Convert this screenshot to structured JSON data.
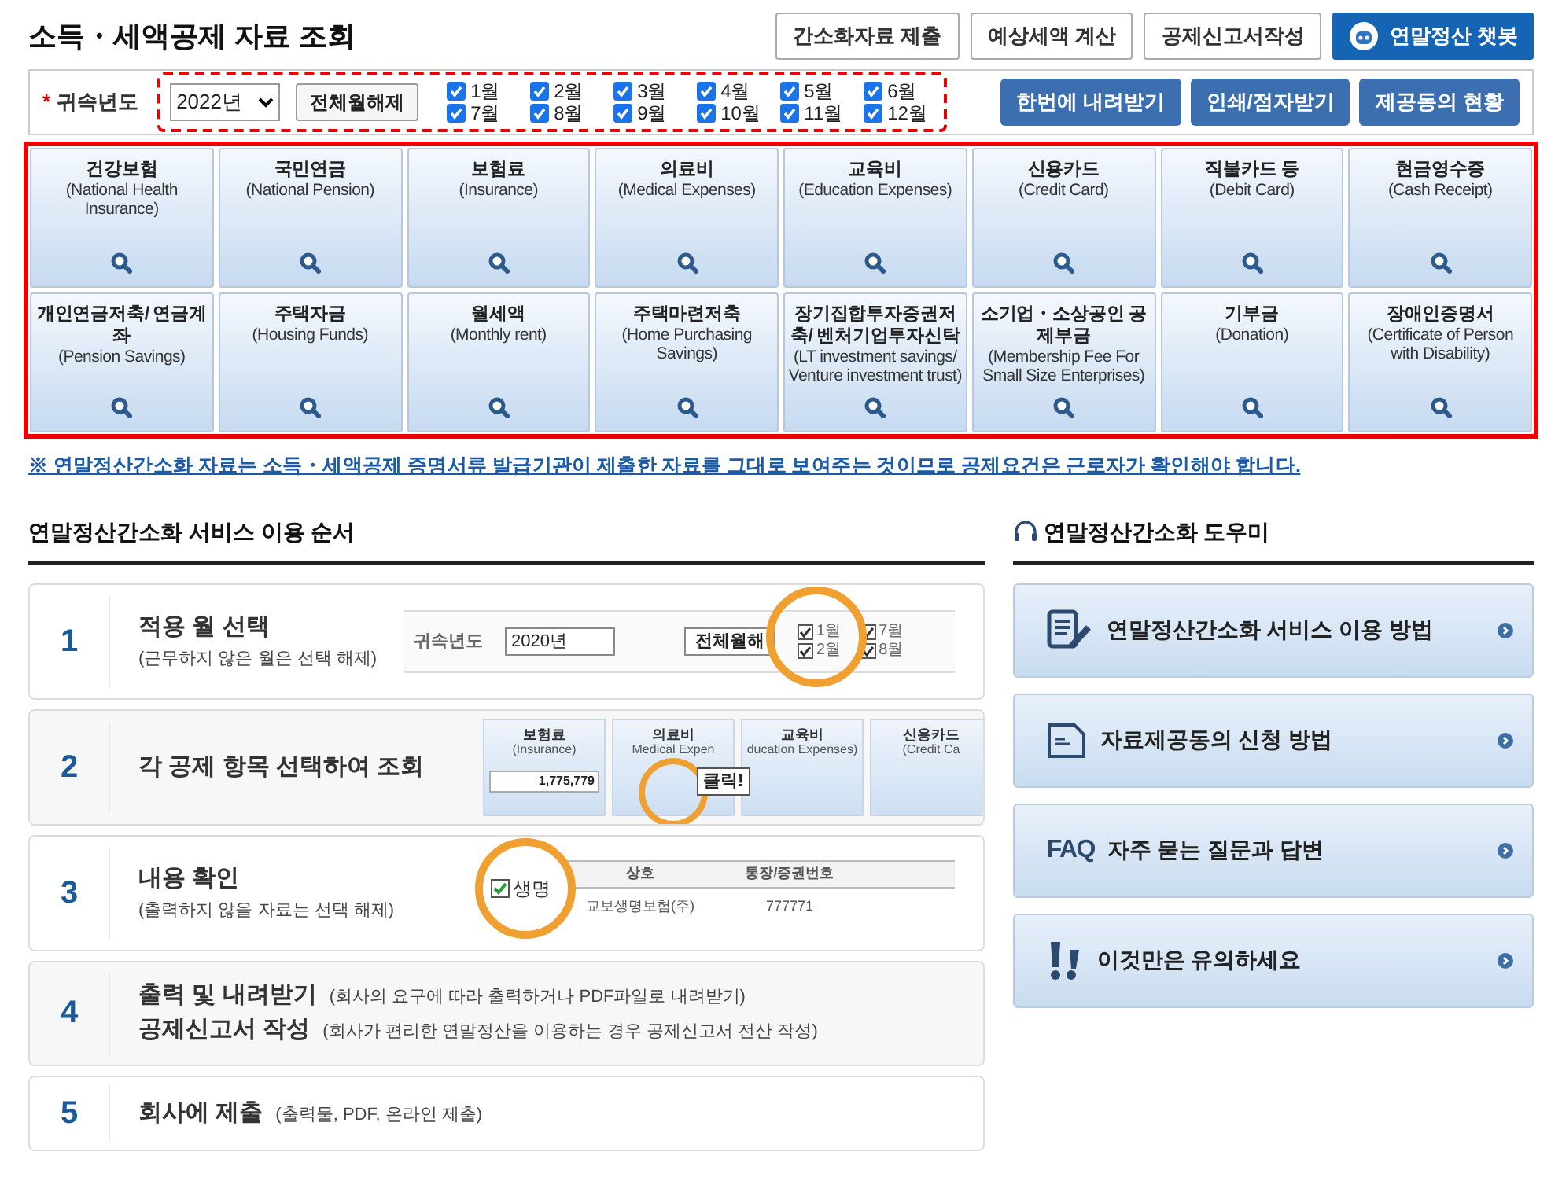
{
  "title": "소득・세액공제 자료 조회",
  "top_buttons": [
    {
      "label": "간소화자료 제출",
      "kind": "plain"
    },
    {
      "label": "예상세액 계산",
      "kind": "plain"
    },
    {
      "label": "공제신고서작성",
      "kind": "plain"
    },
    {
      "label": "연말정산 챗봇",
      "kind": "primary"
    }
  ],
  "filter": {
    "required_mark": "*",
    "label": "귀속년도",
    "year": "2022년",
    "clear_button": "전체월해제",
    "months": [
      {
        "label": "1월",
        "checked": true
      },
      {
        "label": "2월",
        "checked": true
      },
      {
        "label": "3월",
        "checked": true
      },
      {
        "label": "4월",
        "checked": true
      },
      {
        "label": "5월",
        "checked": true
      },
      {
        "label": "6월",
        "checked": true
      },
      {
        "label": "7월",
        "checked": true
      },
      {
        "label": "8월",
        "checked": true
      },
      {
        "label": "9월",
        "checked": true
      },
      {
        "label": "10월",
        "checked": true
      },
      {
        "label": "11월",
        "checked": true
      },
      {
        "label": "12월",
        "checked": true
      }
    ],
    "actions": [
      "한번에 내려받기",
      "인쇄/점자받기",
      "제공동의 현황"
    ]
  },
  "categories": [
    {
      "title": "건강보험",
      "subtitle": "(National Health Insurance)"
    },
    {
      "title": "국민연금",
      "subtitle": "(National Pension)"
    },
    {
      "title": "보험료",
      "subtitle": "(Insurance)"
    },
    {
      "title": "의료비",
      "subtitle": "(Medical Expenses)"
    },
    {
      "title": "교육비",
      "subtitle": "(Education Expenses)"
    },
    {
      "title": "신용카드",
      "subtitle": "(Credit Card)"
    },
    {
      "title": "직불카드 등",
      "subtitle": "(Debit Card)"
    },
    {
      "title": "현금영수증",
      "subtitle": "(Cash Receipt)"
    },
    {
      "title": "개인연금저축/ 연금계좌",
      "subtitle": "(Pension Savings)"
    },
    {
      "title": "주택자금",
      "subtitle": "(Housing Funds)"
    },
    {
      "title": "월세액",
      "subtitle": "(Monthly rent)"
    },
    {
      "title": "주택마련저축",
      "subtitle": "(Home Purchasing Savings)"
    },
    {
      "title": "장기집합투자증권저축/ 벤처기업투자신탁",
      "subtitle": "(LT investment savings/ Venture investment trust)"
    },
    {
      "title": "소기업・소상공인 공제부금",
      "subtitle": "(Membership Fee For Small Size Enterprises)"
    },
    {
      "title": "기부금",
      "subtitle": "(Donation)"
    },
    {
      "title": "장애인증명서",
      "subtitle": "(Certificate of Person with Disability)"
    }
  ],
  "notice": "※ 연말정산간소화 자료는 소득・세액공제 증명서류 발급기관이 제출한 자료를 그대로 보여주는 것이므로 공제요건은 근로자가 확인해야 합니다.",
  "steps_section": {
    "title": "연말정산간소화 서비스 이용 순서",
    "steps": [
      {
        "number": "1",
        "kind": "stacked",
        "lines": [
          {
            "title": "적용 월 선택",
            "note": "(근무하지 않은 월은 선택 해제)"
          }
        ],
        "illustration": {
          "kind": "month-select",
          "label": "귀속년도",
          "year": "2020년",
          "button": "전체월해",
          "months": [
            {
              "label": "1월",
              "checked": true
            },
            {
              "label": "2월",
              "checked": true
            },
            {
              "label": "7월",
              "checked": true
            },
            {
              "label": "8월",
              "checked": true
            }
          ]
        }
      },
      {
        "number": "2",
        "kind": "stacked",
        "lines": [
          {
            "title": "각 공제 항목 선택하여 조회"
          }
        ],
        "illustration": {
          "kind": "category-cards",
          "cards": [
            {
              "title": "보험료",
              "subtitle": "(Insurance)",
              "amount": "1,775,779"
            },
            {
              "title": "의료비",
              "subtitle": "Medical Expen"
            },
            {
              "title": "교육비",
              "subtitle": "ducation Expenses)"
            },
            {
              "title": "신용카드",
              "subtitle": "(Credit Ca"
            }
          ],
          "tooltip": "클릭!"
        }
      },
      {
        "number": "3",
        "kind": "stacked",
        "lines": [
          {
            "title": "내용 확인",
            "note": "(출력하지 않을 자료는 선택 해제)"
          }
        ],
        "illustration": {
          "kind": "table",
          "columns": [
            "상호",
            "통장/증권번호"
          ],
          "zoom_text": "생명",
          "rows": [
            [
              "교보생명보험(주)",
              "777771"
            ]
          ]
        }
      },
      {
        "number": "4",
        "kind": "inline",
        "lines": [
          {
            "title": "출력 및 내려받기",
            "note": "(회사의 요구에 따라 출력하거나 PDF파일로 내려받기)"
          },
          {
            "title": "공제신고서 작성",
            "note": "(회사가 편리한 연말정산을 이용하는 경우 공제신고서 전산 작성)"
          }
        ]
      },
      {
        "number": "5",
        "kind": "inline",
        "lines": [
          {
            "title": "회사에 제출",
            "note": "(출력물, PDF, 온라인 제출)"
          }
        ]
      }
    ]
  },
  "helper": {
    "title": "연말정산간소화 도우미",
    "items": [
      {
        "label": "연말정산간소화 서비스 이용 방법",
        "kind": "guide"
      },
      {
        "label": "자료제공동의 신청 방법",
        "kind": "form"
      },
      {
        "label": "자주 묻는 질문과 답변",
        "kind": "faq",
        "icon_text": "FAQ"
      },
      {
        "label": "이것만은 유의하세요",
        "kind": "caution"
      }
    ]
  }
}
